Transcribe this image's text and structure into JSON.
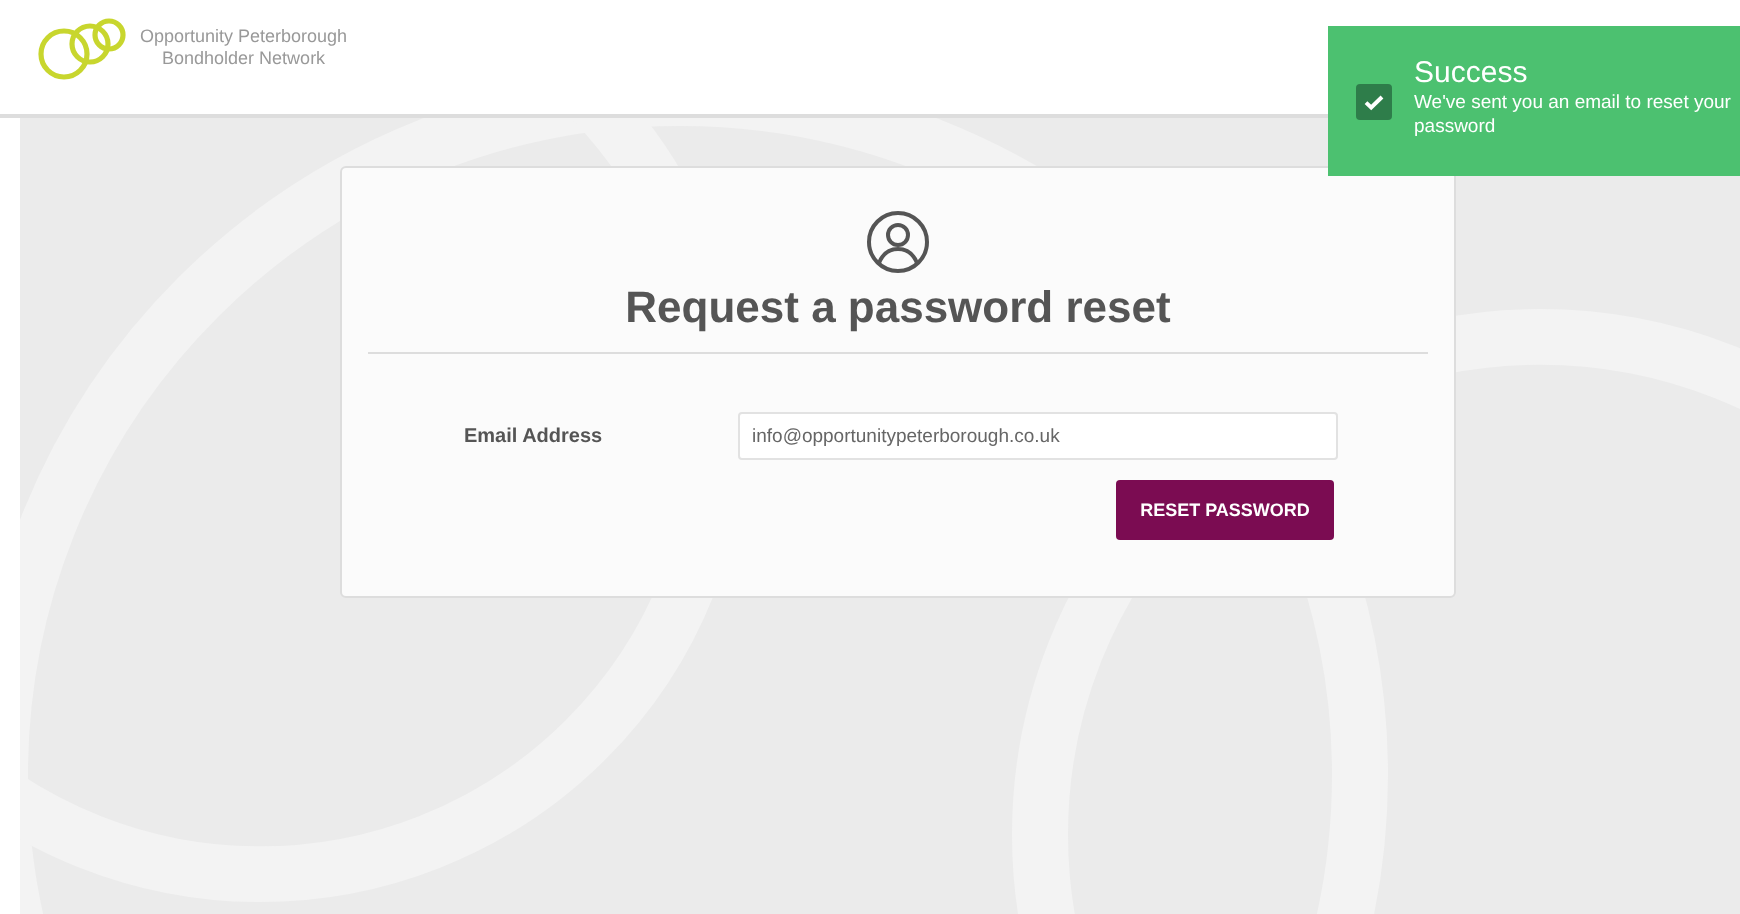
{
  "header": {
    "brand_line_1": "Opportunity Peterborough",
    "brand_line_2": "Bondholder Network"
  },
  "form": {
    "title": "Request a password reset",
    "email_label": "Email Address",
    "email_value": "info@opportunitypeterborough.co.uk",
    "submit": "RESET PASSWORD"
  },
  "toast": {
    "kind": "success",
    "title": "Success",
    "message": "We've sent you an email to reset your password"
  }
}
